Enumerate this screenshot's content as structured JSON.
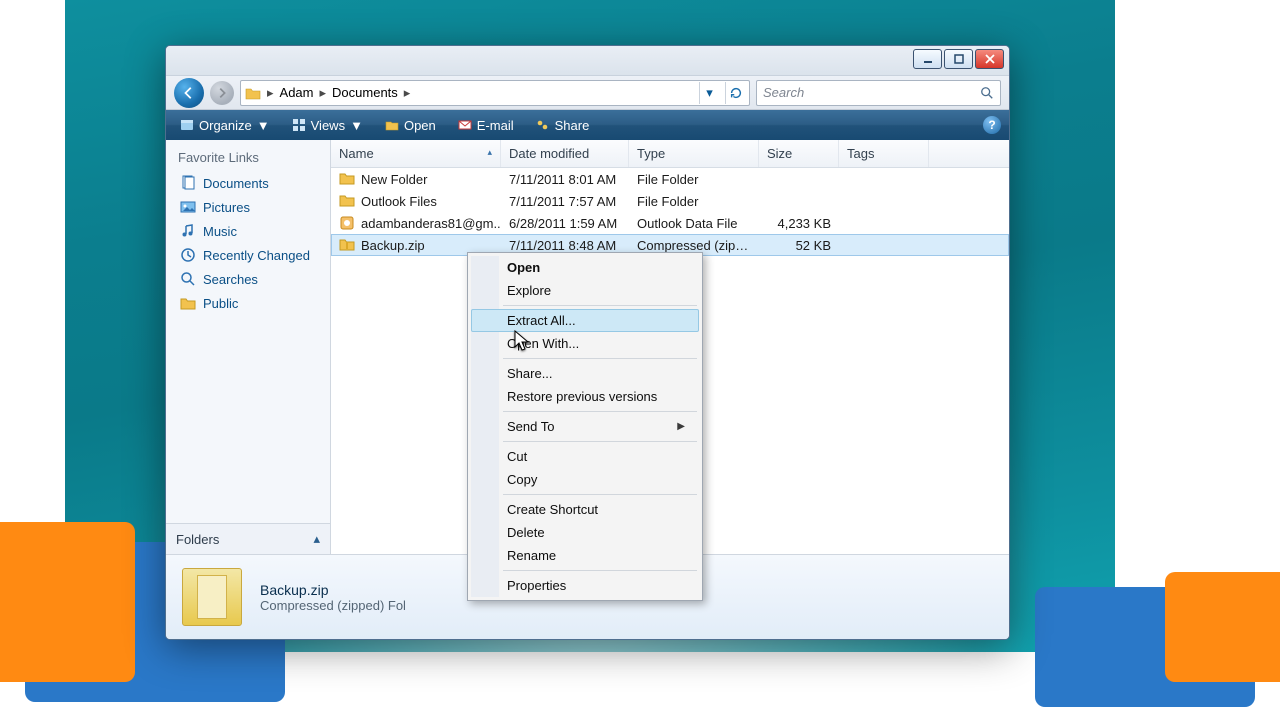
{
  "window_controls": {
    "min": "_",
    "max": "□",
    "close": "X"
  },
  "breadcrumb": {
    "root_icon": "folder",
    "parts": [
      "Adam",
      "Documents"
    ]
  },
  "search": {
    "placeholder": "Search"
  },
  "toolbar": {
    "organize": "Organize",
    "views": "Views",
    "open": "Open",
    "email": "E-mail",
    "share": "Share",
    "help": "?"
  },
  "sidebar": {
    "header": "Favorite Links",
    "items": [
      {
        "label": "Documents",
        "icon": "documents"
      },
      {
        "label": "Pictures",
        "icon": "pictures"
      },
      {
        "label": "Music",
        "icon": "music"
      },
      {
        "label": "Recently Changed",
        "icon": "recent"
      },
      {
        "label": "Searches",
        "icon": "search"
      },
      {
        "label": "Public",
        "icon": "folder"
      }
    ],
    "folders_label": "Folders"
  },
  "columns": {
    "name": "Name",
    "date": "Date modified",
    "type": "Type",
    "size": "Size",
    "tags": "Tags"
  },
  "rows": [
    {
      "name": "New Folder",
      "date": "7/11/2011 8:01 AM",
      "type": "File Folder",
      "size": "",
      "icon": "folder",
      "selected": false
    },
    {
      "name": "Outlook Files",
      "date": "7/11/2011 7:57 AM",
      "type": "File Folder",
      "size": "",
      "icon": "folder",
      "selected": false
    },
    {
      "name": "adambanderas81@gm...",
      "date": "6/28/2011 1:59 AM",
      "type": "Outlook Data File",
      "size": "4,233 KB",
      "icon": "pst",
      "selected": false
    },
    {
      "name": "Backup.zip",
      "date": "7/11/2011 8:48 AM",
      "type": "Compressed (zipp...",
      "size": "52 KB",
      "icon": "zip",
      "selected": true
    }
  ],
  "details": {
    "filename": "Backup.zip",
    "subtitle": "Compressed (zipped) Fol"
  },
  "context_menu": {
    "items": [
      {
        "label": "Open",
        "bold": true
      },
      {
        "label": "Explore"
      },
      {
        "sep": true
      },
      {
        "label": "Extract All...",
        "hover": true
      },
      {
        "label": "Open With..."
      },
      {
        "sep": true
      },
      {
        "label": "Share..."
      },
      {
        "label": "Restore previous versions"
      },
      {
        "sep": true
      },
      {
        "label": "Send To",
        "submenu": true
      },
      {
        "sep": true
      },
      {
        "label": "Cut"
      },
      {
        "label": "Copy"
      },
      {
        "sep": true
      },
      {
        "label": "Create Shortcut"
      },
      {
        "label": "Delete"
      },
      {
        "label": "Rename"
      },
      {
        "sep": true
      },
      {
        "label": "Properties"
      }
    ]
  }
}
